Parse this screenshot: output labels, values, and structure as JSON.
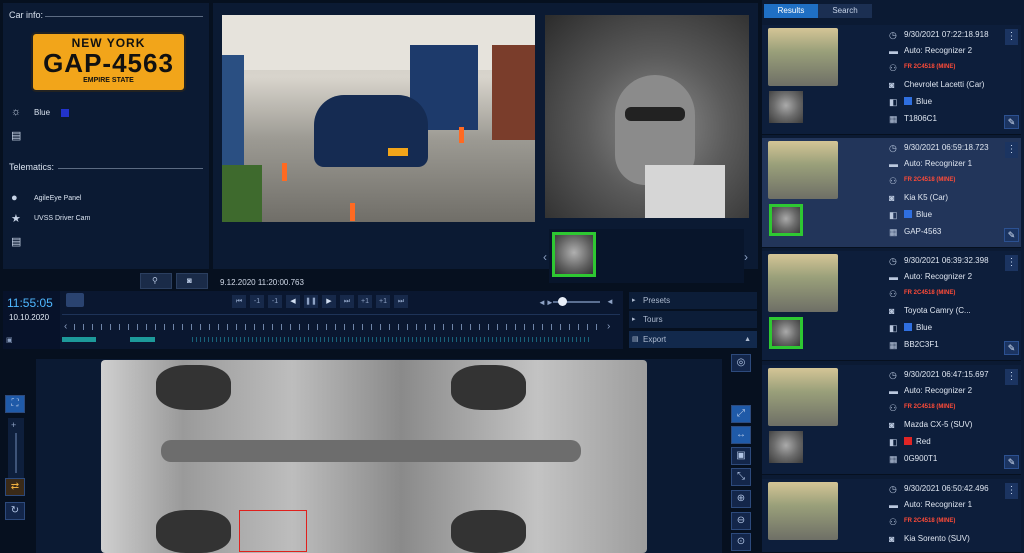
{
  "car_info": {
    "title": "Car info:",
    "plate": {
      "state": "NEW YORK",
      "number": "GAP-4563",
      "subtitle": "EMPIRE STATE"
    },
    "color_label": "Blue",
    "color_hex": "#2233cc"
  },
  "telematics": {
    "title": "Telematics:",
    "items": [
      {
        "label": "AgileEye Panel",
        "icon": "person-icon"
      },
      {
        "label": "UVSS Driver Cam",
        "icon": "star-icon"
      }
    ]
  },
  "player": {
    "timestamp": "9.12.2020 11:20:00.763",
    "clock_time": "11:55:05",
    "clock_date": "10.10.2020",
    "speed_buttons": [
      "-1",
      "-1",
      "+1",
      "+1"
    ]
  },
  "side_controls": {
    "presets": "Presets",
    "tours": "Tours",
    "export": "Export"
  },
  "results_panel": {
    "tabs": [
      "Results",
      "Search"
    ],
    "active_tab": "Results",
    "cards": [
      {
        "datetime": "9/30/2021 07:22:18.918",
        "recognizer": "Auto: Recognizer 2",
        "owner": "FR 2C4518 (MINE)",
        "model": "Chevrolet Lacetti (Car)",
        "color": "Blue",
        "color_hex": "#2f6fe0",
        "plate": "T1806C1",
        "selected": false,
        "face_green": false
      },
      {
        "datetime": "9/30/2021 06:59:18.723",
        "recognizer": "Auto: Recognizer 1",
        "owner": "FR 2C4518 (MINE)",
        "model": "Kia K5 (Car)",
        "color": "Blue",
        "color_hex": "#2f6fe0",
        "plate": "GAP-4563",
        "selected": true,
        "face_green": true
      },
      {
        "datetime": "9/30/2021 06:39:32.398",
        "recognizer": "Auto: Recognizer 2",
        "owner": "FR 2C4518 (MINE)",
        "model": "Toyota Camry (C...",
        "color": "Blue",
        "color_hex": "#2f6fe0",
        "plate": "BB2C3F1",
        "selected": false,
        "face_green": true
      },
      {
        "datetime": "9/30/2021 06:47:15.697",
        "recognizer": "Auto: Recognizer 2",
        "owner": "FR 2C4518 (MINE)",
        "model": "Mazda CX-5 (SUV)",
        "color": "Red",
        "color_hex": "#e02525",
        "plate": "0G900T1",
        "selected": false,
        "face_green": false
      },
      {
        "datetime": "9/30/2021 06:50:42.496",
        "recognizer": "Auto: Recognizer 1",
        "owner": "FR 2C4518 (MINE)",
        "model": "Kia Sorento (SUV)",
        "color": "",
        "color_hex": "",
        "plate": "",
        "selected": false,
        "face_green": false
      }
    ]
  }
}
